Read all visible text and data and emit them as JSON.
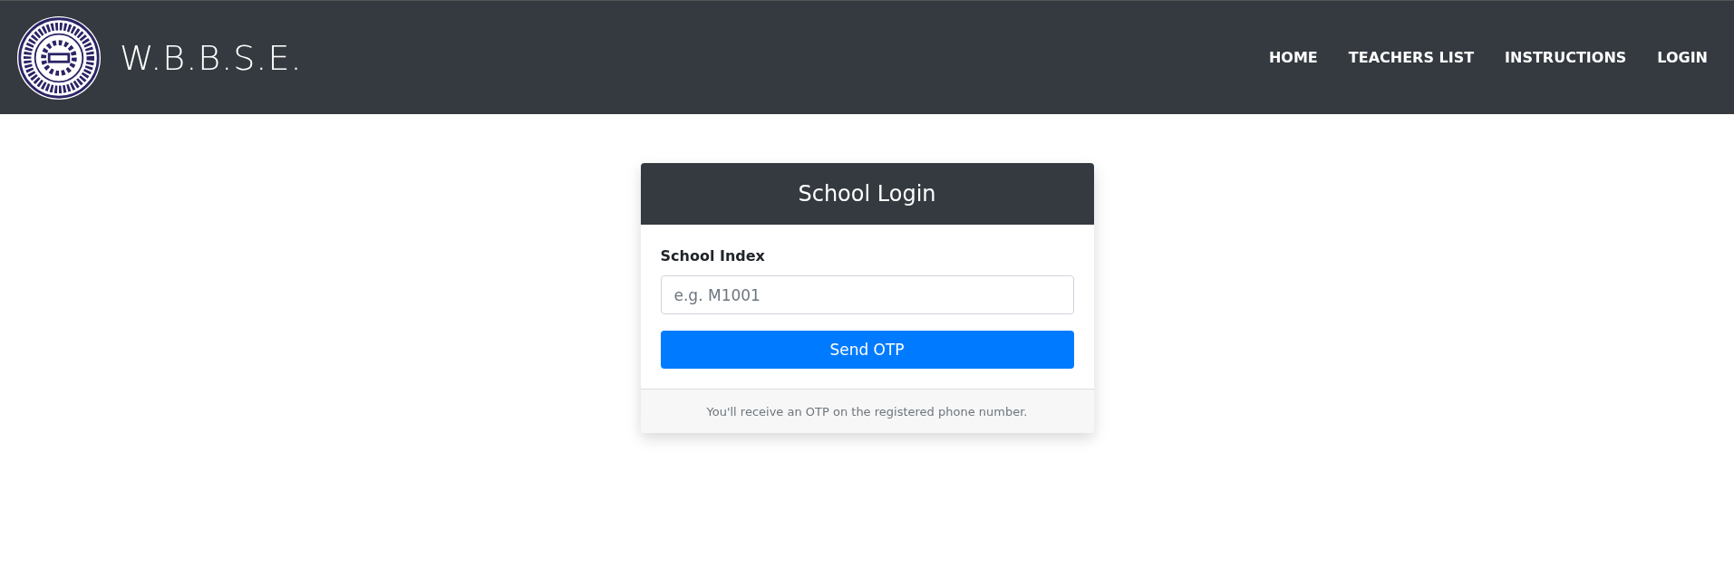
{
  "navbar": {
    "brand": "W.B.B.S.E.",
    "links": [
      {
        "label": "HOME"
      },
      {
        "label": "TEACHERS LIST"
      },
      {
        "label": "INSTRUCTIONS"
      },
      {
        "label": "LOGIN"
      }
    ]
  },
  "login_card": {
    "title": "School Login",
    "field": {
      "label": "School Index",
      "placeholder": "e.g. M1001"
    },
    "button": "Send OTP",
    "footer": "You'll receive an OTP on the registered phone number."
  }
}
